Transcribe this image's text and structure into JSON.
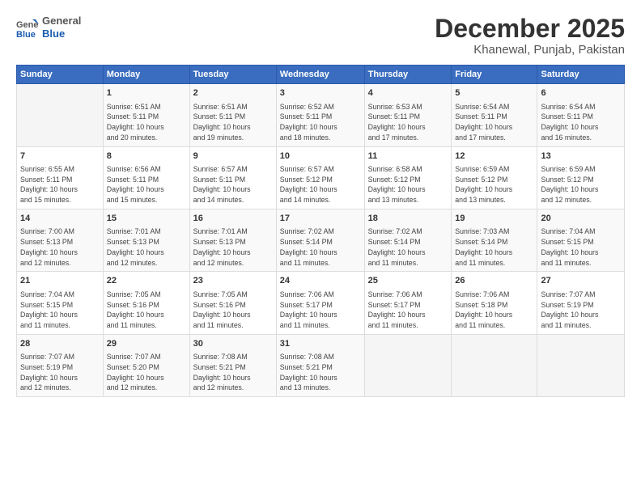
{
  "header": {
    "logo_line1": "General",
    "logo_line2": "Blue",
    "month_title": "December 2025",
    "subtitle": "Khanewal, Punjab, Pakistan"
  },
  "days_of_week": [
    "Sunday",
    "Monday",
    "Tuesday",
    "Wednesday",
    "Thursday",
    "Friday",
    "Saturday"
  ],
  "weeks": [
    [
      {
        "day": "",
        "content": ""
      },
      {
        "day": "1",
        "content": "Sunrise: 6:51 AM\nSunset: 5:11 PM\nDaylight: 10 hours\nand 20 minutes."
      },
      {
        "day": "2",
        "content": "Sunrise: 6:51 AM\nSunset: 5:11 PM\nDaylight: 10 hours\nand 19 minutes."
      },
      {
        "day": "3",
        "content": "Sunrise: 6:52 AM\nSunset: 5:11 PM\nDaylight: 10 hours\nand 18 minutes."
      },
      {
        "day": "4",
        "content": "Sunrise: 6:53 AM\nSunset: 5:11 PM\nDaylight: 10 hours\nand 17 minutes."
      },
      {
        "day": "5",
        "content": "Sunrise: 6:54 AM\nSunset: 5:11 PM\nDaylight: 10 hours\nand 17 minutes."
      },
      {
        "day": "6",
        "content": "Sunrise: 6:54 AM\nSunset: 5:11 PM\nDaylight: 10 hours\nand 16 minutes."
      }
    ],
    [
      {
        "day": "7",
        "content": "Sunrise: 6:55 AM\nSunset: 5:11 PM\nDaylight: 10 hours\nand 15 minutes."
      },
      {
        "day": "8",
        "content": "Sunrise: 6:56 AM\nSunset: 5:11 PM\nDaylight: 10 hours\nand 15 minutes."
      },
      {
        "day": "9",
        "content": "Sunrise: 6:57 AM\nSunset: 5:11 PM\nDaylight: 10 hours\nand 14 minutes."
      },
      {
        "day": "10",
        "content": "Sunrise: 6:57 AM\nSunset: 5:12 PM\nDaylight: 10 hours\nand 14 minutes."
      },
      {
        "day": "11",
        "content": "Sunrise: 6:58 AM\nSunset: 5:12 PM\nDaylight: 10 hours\nand 13 minutes."
      },
      {
        "day": "12",
        "content": "Sunrise: 6:59 AM\nSunset: 5:12 PM\nDaylight: 10 hours\nand 13 minutes."
      },
      {
        "day": "13",
        "content": "Sunrise: 6:59 AM\nSunset: 5:12 PM\nDaylight: 10 hours\nand 12 minutes."
      }
    ],
    [
      {
        "day": "14",
        "content": "Sunrise: 7:00 AM\nSunset: 5:13 PM\nDaylight: 10 hours\nand 12 minutes."
      },
      {
        "day": "15",
        "content": "Sunrise: 7:01 AM\nSunset: 5:13 PM\nDaylight: 10 hours\nand 12 minutes."
      },
      {
        "day": "16",
        "content": "Sunrise: 7:01 AM\nSunset: 5:13 PM\nDaylight: 10 hours\nand 12 minutes."
      },
      {
        "day": "17",
        "content": "Sunrise: 7:02 AM\nSunset: 5:14 PM\nDaylight: 10 hours\nand 11 minutes."
      },
      {
        "day": "18",
        "content": "Sunrise: 7:02 AM\nSunset: 5:14 PM\nDaylight: 10 hours\nand 11 minutes."
      },
      {
        "day": "19",
        "content": "Sunrise: 7:03 AM\nSunset: 5:14 PM\nDaylight: 10 hours\nand 11 minutes."
      },
      {
        "day": "20",
        "content": "Sunrise: 7:04 AM\nSunset: 5:15 PM\nDaylight: 10 hours\nand 11 minutes."
      }
    ],
    [
      {
        "day": "21",
        "content": "Sunrise: 7:04 AM\nSunset: 5:15 PM\nDaylight: 10 hours\nand 11 minutes."
      },
      {
        "day": "22",
        "content": "Sunrise: 7:05 AM\nSunset: 5:16 PM\nDaylight: 10 hours\nand 11 minutes."
      },
      {
        "day": "23",
        "content": "Sunrise: 7:05 AM\nSunset: 5:16 PM\nDaylight: 10 hours\nand 11 minutes."
      },
      {
        "day": "24",
        "content": "Sunrise: 7:06 AM\nSunset: 5:17 PM\nDaylight: 10 hours\nand 11 minutes."
      },
      {
        "day": "25",
        "content": "Sunrise: 7:06 AM\nSunset: 5:17 PM\nDaylight: 10 hours\nand 11 minutes."
      },
      {
        "day": "26",
        "content": "Sunrise: 7:06 AM\nSunset: 5:18 PM\nDaylight: 10 hours\nand 11 minutes."
      },
      {
        "day": "27",
        "content": "Sunrise: 7:07 AM\nSunset: 5:19 PM\nDaylight: 10 hours\nand 11 minutes."
      }
    ],
    [
      {
        "day": "28",
        "content": "Sunrise: 7:07 AM\nSunset: 5:19 PM\nDaylight: 10 hours\nand 12 minutes."
      },
      {
        "day": "29",
        "content": "Sunrise: 7:07 AM\nSunset: 5:20 PM\nDaylight: 10 hours\nand 12 minutes."
      },
      {
        "day": "30",
        "content": "Sunrise: 7:08 AM\nSunset: 5:21 PM\nDaylight: 10 hours\nand 12 minutes."
      },
      {
        "day": "31",
        "content": "Sunrise: 7:08 AM\nSunset: 5:21 PM\nDaylight: 10 hours\nand 13 minutes."
      },
      {
        "day": "",
        "content": ""
      },
      {
        "day": "",
        "content": ""
      },
      {
        "day": "",
        "content": ""
      }
    ]
  ]
}
